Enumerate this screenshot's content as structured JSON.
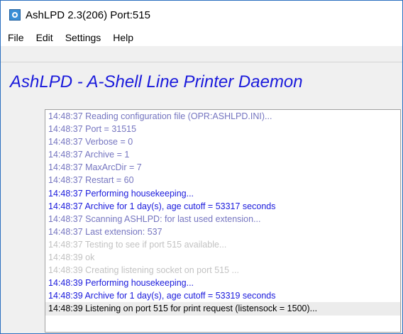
{
  "window": {
    "title": "AshLPD 2.3(206) Port:515"
  },
  "menu": {
    "items": [
      "File",
      "Edit",
      "Settings",
      "Help"
    ]
  },
  "header": {
    "heading": "AshLPD - A-Shell Line Printer Daemon"
  },
  "log": {
    "lines": [
      {
        "time": "14:48:37",
        "text": "Reading configuration file (OPR:ASHLPD.INI)...",
        "level": "normal"
      },
      {
        "time": "14:48:37",
        "text": " Port = 31515",
        "level": "normal"
      },
      {
        "time": "14:48:37",
        "text": " Verbose = 0",
        "level": "normal"
      },
      {
        "time": "14:48:37",
        "text": " Archive = 1",
        "level": "normal"
      },
      {
        "time": "14:48:37",
        "text": " MaxArcDir = 7",
        "level": "normal"
      },
      {
        "time": "14:48:37",
        "text": " Restart = 60",
        "level": "normal"
      },
      {
        "time": "14:48:37",
        "text": "Performing housekeeping...",
        "level": "highlight"
      },
      {
        "time": "14:48:37",
        "text": " Archive for 1 day(s), age cutoff = 53317 seconds",
        "level": "highlight"
      },
      {
        "time": "14:48:37",
        "text": "Scanning ASHLPD: for last used extension...",
        "level": "normal"
      },
      {
        "time": "14:48:37",
        "text": " Last extension: 537",
        "level": "normal"
      },
      {
        "time": "14:48:37",
        "text": " Testing to see if port 515 available...",
        "level": "faded"
      },
      {
        "time": "14:48:39",
        "text": " ok",
        "level": "faded"
      },
      {
        "time": "14:48:39",
        "text": "Creating listening socket on port 515 ...",
        "level": "faded"
      },
      {
        "time": "14:48:39",
        "text": "Performing housekeeping...",
        "level": "highlight"
      },
      {
        "time": "14:48:39",
        "text": " Archive for 1 day(s), age cutoff = 53319 seconds",
        "level": "highlight"
      },
      {
        "time": "14:48:39",
        "text": "Listening on port 515 for print request (listensock = 1500)...",
        "level": "current"
      }
    ]
  }
}
